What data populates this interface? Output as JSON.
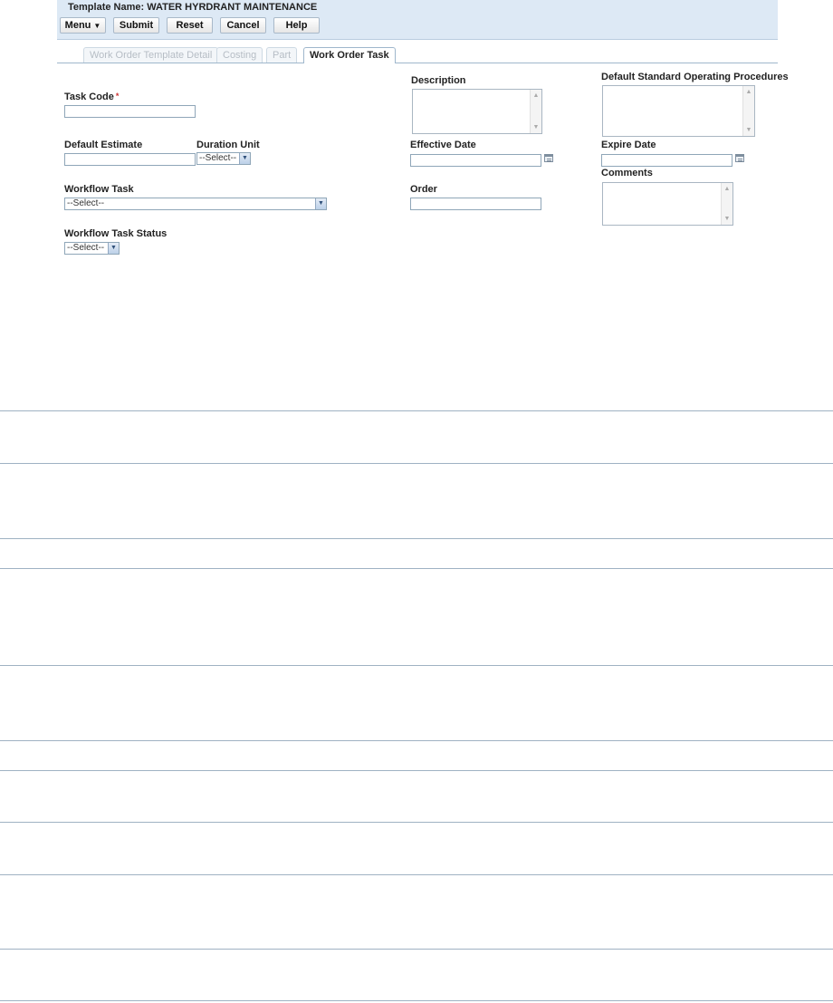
{
  "header": {
    "title": "Template Name: WATER HYRDRANT MAINTENANCE"
  },
  "toolbar": {
    "menu_label": "Menu",
    "submit_label": "Submit",
    "reset_label": "Reset",
    "cancel_label": "Cancel",
    "help_label": "Help"
  },
  "tabs": [
    {
      "label": "Work Order Template Detail",
      "active": false
    },
    {
      "label": "Costing",
      "active": false
    },
    {
      "label": "Part",
      "active": false
    },
    {
      "label": "Work Order Task",
      "active": true
    }
  ],
  "form": {
    "task_code": {
      "label": "Task Code",
      "required_mark": "*",
      "value": ""
    },
    "default_estimate": {
      "label": "Default Estimate",
      "value": ""
    },
    "duration_unit": {
      "label": "Duration Unit",
      "selected": "--Select--"
    },
    "workflow_task": {
      "label": "Workflow Task",
      "selected": "--Select--"
    },
    "workflow_task_status": {
      "label": "Workflow Task Status",
      "selected": "--Select--"
    },
    "description": {
      "label": "Description",
      "value": ""
    },
    "effective_date": {
      "label": "Effective Date",
      "value": ""
    },
    "order": {
      "label": "Order",
      "value": ""
    },
    "default_sop": {
      "label": "Default Standard Operating Procedures",
      "value": ""
    },
    "expire_date": {
      "label": "Expire Date",
      "value": ""
    },
    "comments": {
      "label": "Comments",
      "value": ""
    }
  },
  "icons": {
    "calendar": "calendar-icon",
    "dropdown": "chevron-down-icon",
    "menu_caret": "caret-down-icon"
  },
  "colors": {
    "header_bg": "#dde9f5",
    "divider": "#9fb2c3",
    "required": "#cc3333"
  }
}
